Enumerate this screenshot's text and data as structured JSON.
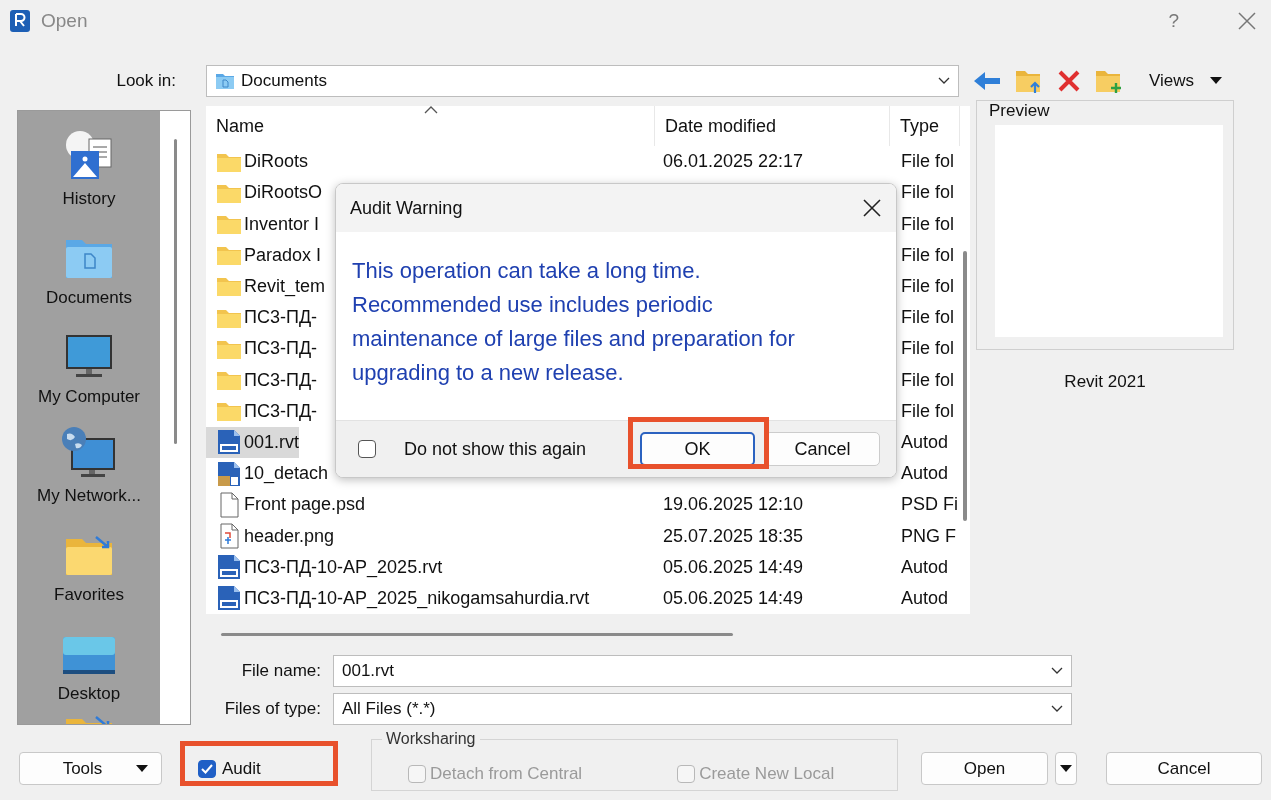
{
  "window": {
    "title": "Open",
    "help": "?"
  },
  "look_in": {
    "label": "Look in:",
    "value": "Documents"
  },
  "toolbar": {
    "views": "Views"
  },
  "sidebar": {
    "items": [
      {
        "kind": "history",
        "label": "History"
      },
      {
        "kind": "documents",
        "label": "Documents"
      },
      {
        "kind": "computer",
        "label": "My Computer"
      },
      {
        "kind": "network",
        "label": "My Network..."
      },
      {
        "kind": "favorites",
        "label": "Favorites"
      },
      {
        "kind": "desktop",
        "label": "Desktop"
      },
      {
        "kind": "favorites"
      }
    ]
  },
  "file_list": {
    "columns": [
      "Name",
      "Date modified",
      "Type"
    ],
    "rows": [
      {
        "kind": "folder",
        "name": "DiRoots",
        "date": "06.01.2025 22:17",
        "type": "File fol",
        "selected": false
      },
      {
        "kind": "folder",
        "name": "DiRootsO",
        "type": "File fol",
        "selected": false
      },
      {
        "kind": "folder",
        "name": "Inventor I",
        "type": "File fol",
        "selected": false
      },
      {
        "kind": "folder",
        "name": "Paradox I",
        "type": "File fol",
        "selected": false
      },
      {
        "kind": "folder",
        "name": "Revit_tem",
        "type": "File fol",
        "selected": false
      },
      {
        "kind": "folder",
        "name": "ПС3-ПД-",
        "type": "File fol",
        "selected": false
      },
      {
        "kind": "folder",
        "name": "ПС3-ПД-",
        "type": "File fol",
        "selected": false
      },
      {
        "kind": "folder",
        "name": "ПС3-ПД-",
        "type": "File fol",
        "selected": false
      },
      {
        "kind": "folder",
        "name": "ПС3-ПД-",
        "type": "File fol",
        "selected": false
      },
      {
        "kind": "rvt",
        "name": "001.rvt",
        "type": "Autod",
        "selected": true
      },
      {
        "kind": "rvt-detached",
        "name": "10_detach",
        "type": "Autod",
        "selected": false
      },
      {
        "kind": "file",
        "name": "Front page.psd",
        "date": "19.06.2025 12:10",
        "type": "PSD Fi",
        "selected": false
      },
      {
        "kind": "image",
        "name": "header.png",
        "date": "25.07.2025 18:35",
        "type": "PNG F",
        "selected": false
      },
      {
        "kind": "rvt",
        "name": "ПС3-ПД-10-АР_2025.rvt",
        "date": "05.06.2025 14:49",
        "type": "Autod",
        "selected": false
      },
      {
        "kind": "rvt",
        "name": "ПС3-ПД-10-АР_2025_nikogamsahurdia.rvt",
        "date": "05.06.2025 14:49",
        "type": "Autod",
        "selected": false
      }
    ]
  },
  "preview": {
    "label": "Preview",
    "caption": "Revit 2021"
  },
  "file_name": {
    "label": "File name:",
    "value": "001.rvt"
  },
  "files_of_type": {
    "label": "Files of type:",
    "value": "All Files (*.*)"
  },
  "bottom_bar": {
    "tools": "Tools",
    "audit": {
      "label": "Audit",
      "checked": true
    },
    "worksharing": {
      "label": "Worksharing",
      "options": [
        {
          "label": "Detach from Central",
          "checked": false,
          "disabled": true
        },
        {
          "label": "Create New Local",
          "checked": false,
          "disabled": true
        }
      ]
    },
    "open": "Open",
    "cancel": "Cancel"
  },
  "audit_warning": {
    "title": "Audit Warning",
    "message": "This operation can take a long time.\nRecommended use includes periodic maintenance of large files and preparation for upgrading to a new release.",
    "dont_show": {
      "label": "Do not show this again",
      "checked": false
    },
    "ok": "OK",
    "cancel": "Cancel"
  }
}
